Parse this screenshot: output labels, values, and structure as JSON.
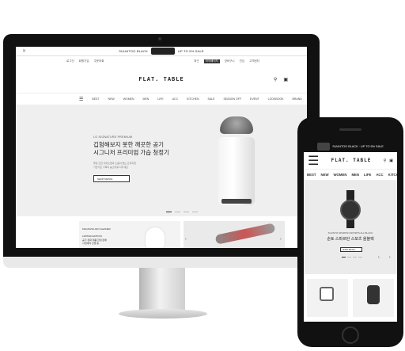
{
  "desktop": {
    "promo": {
      "close": "✕",
      "text_left": "SUUNTOO BLACK",
      "text_right": "UP TO 5% SALE"
    },
    "util_left": [
      "로그인",
      "회원가입",
      "주문조회"
    ],
    "util_right": [
      "최근",
      "마이페이지",
      "장바구니",
      "관심",
      "고객센터"
    ],
    "util_highlight_index": 1,
    "logo": "FLAT. TABLE",
    "search_icon": "search-icon",
    "bag_icon": "bag-icon",
    "nav": [
      "BEST",
      "NEW",
      "WOMEN",
      "MEN",
      "LIFE",
      "ACC",
      "KITCHEN",
      "SALE",
      "SEASON OFF",
      "EVENT",
      "LOOKBOOK",
      "BRAND"
    ],
    "hero": {
      "sub": "LG SIGNATURE PREMIUM",
      "title": "깁험해보지 못한 깨끗한 공기\n시그니처 프리미엄 가습 청정기",
      "body": "물로 인한 이차오염과 소음이 없는 프리미엄\n가습기로 가족의 숨소리를 지키세요",
      "button": "SHOP DETAIL"
    },
    "card1": {
      "text": "MAGNUSA AIR CLEANER\n\nLIMITED EDITION\n공기 정화 제품 한정 판매\n사전예약 진행 중"
    }
  },
  "phone": {
    "promo": "SUUNTOO BLACK · UP TO 5% SALE",
    "logo": "FLAT. TABLE",
    "nav": [
      "BEST",
      "NEW",
      "WOMEN",
      "MEN",
      "LIFE",
      "ACC",
      "KITCHEN"
    ],
    "hero": {
      "sub": "SUUNTO SPARTAN SPORTS ALL BLACK",
      "title": "순토 스파르탄 스포츠 올블랙",
      "button": "SHOP DETAIL",
      "prev": "‹",
      "next": "›"
    }
  },
  "colors": {
    "frame": "#111111",
    "hero_bg": "#efefef",
    "accent": "#222222"
  }
}
